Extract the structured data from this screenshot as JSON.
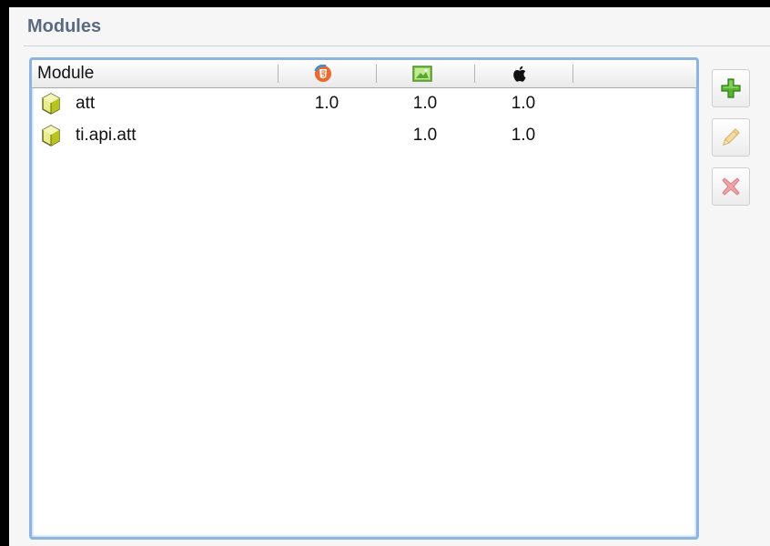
{
  "section": {
    "title": "Modules"
  },
  "table": {
    "columns": [
      {
        "label": "Module",
        "icon": null
      },
      {
        "label": "",
        "icon": "html5-icon"
      },
      {
        "label": "",
        "icon": "android-icon"
      },
      {
        "label": "",
        "icon": "apple-icon"
      }
    ],
    "rows": [
      {
        "name": "att",
        "mobileweb": "1.0",
        "android": "1.0",
        "iphone": "1.0"
      },
      {
        "name": "ti.api.att",
        "mobileweb": "",
        "android": "1.0",
        "iphone": "1.0"
      }
    ]
  },
  "actions": {
    "add": {
      "icon": "plus-icon",
      "color": "#3f9c1e"
    },
    "edit": {
      "icon": "pencil-icon",
      "color": "#e9c77a"
    },
    "remove": {
      "icon": "remove-x-icon",
      "color": "#e3848a"
    }
  },
  "colors": {
    "title": "#5a6b80",
    "table_border": "#8fb4e0",
    "module_icon": "#c9d61a"
  }
}
